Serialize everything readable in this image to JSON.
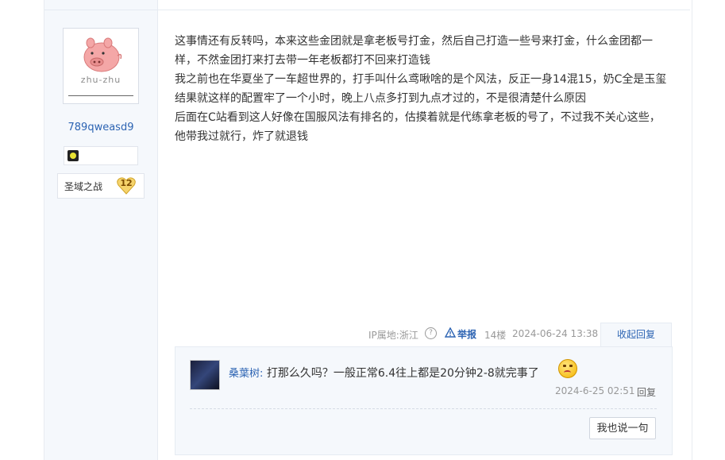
{
  "post": {
    "author": {
      "avatar_caption": "zhu-zhu",
      "username": "789qweasd9",
      "game": "圣域之战",
      "level": "12"
    },
    "paragraphs": [
      "这事情还有反转吗，本来这些金团就是拿老板号打金，然后自己打造一些号来打金，什么金团都一样，不然金团打来打去带一年老板都打不回来打造钱",
      "我之前也在华夏坐了一车超世界的，打手叫什么鸢啾啥的是个风法，反正一身14混15，奶C全是玉玺结果就这样的配置牢了一个小时，晚上八点多打到九点才过的，不是很清楚什么原因",
      "后面在C站看到这人好像在国服风法有排名的，估摸着就是代练拿老板的号了，不过我不关心这些，他带我过就行，炸了就退钱"
    ],
    "meta": {
      "ip": "IP属地:浙江",
      "report": "举报",
      "floor": "14楼",
      "date": "2024-06-24 13:38",
      "collapse": "收起回复"
    }
  },
  "reply": {
    "user": "桑葉树:",
    "text": " 打那么久吗？一般正常6.4往上都是20分钟2-8就完事了",
    "date": "2024-6-25 02:51",
    "action": "回复",
    "say_button": "我也说一句"
  },
  "colors": {
    "link": "#2d64b3",
    "sidebar_bg": "#f5f8fc"
  }
}
